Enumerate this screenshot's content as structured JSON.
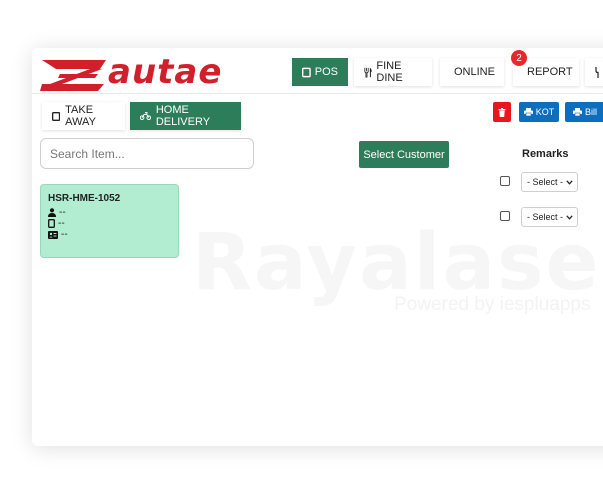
{
  "brand": {
    "logo_text": "autae",
    "watermark": "Rayalase",
    "watermark_sub": "Powered by iespluapps"
  },
  "colors": {
    "brand_red": "#d1202c",
    "primary_green": "#2e7d5a",
    "danger_red": "#e8171b",
    "action_blue": "#0d6ebd",
    "order_card_bg": "#b2ecd1",
    "badge_red": "#e8262e"
  },
  "nav": {
    "items": [
      {
        "label": "POS",
        "icon": "tablet-icon",
        "active": true
      },
      {
        "label": "FINE DINE",
        "icon": "utensils-icon",
        "active": false
      },
      {
        "label": "ONLINE",
        "icon": "mobile-icon",
        "active": false
      },
      {
        "label": "REPORT",
        "icon": "copy-icon",
        "active": false,
        "badge": "2"
      }
    ]
  },
  "mode_tabs": [
    {
      "label": "TAKE AWAY",
      "icon": "tablet-icon",
      "active": false
    },
    {
      "label": "HOME DELIVERY",
      "icon": "motorcycle-icon",
      "active": true
    }
  ],
  "actions": {
    "delete_icon": "trash-icon",
    "kot_label": "KOT",
    "bill_label": "Bill"
  },
  "search": {
    "placeholder": "Search Item..."
  },
  "customer": {
    "select_label": "Select Customer"
  },
  "remarks": {
    "label": "Remarks",
    "rows": [
      {
        "checked": false,
        "selected": "- Select -"
      },
      {
        "checked": false,
        "selected": "- Select -"
      }
    ]
  },
  "orders": [
    {
      "id": "HSR-HME-1052",
      "customer": "--",
      "phone": "--",
      "address": "--"
    }
  ]
}
